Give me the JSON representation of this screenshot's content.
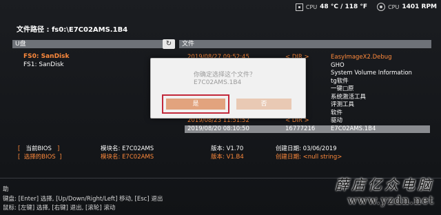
{
  "status": {
    "cpu_temp_label": "CPU",
    "cpu_temp_value": "48 °C / 118 °F",
    "cpu_fan_label": "CPU",
    "cpu_fan_value": "1401 RPM"
  },
  "path": {
    "label": "文件路径 : fs0:\\E7C02AMS.1B4"
  },
  "left_panel": {
    "title": "U盘",
    "refresh_icon": "↻",
    "drives": [
      {
        "label": "FS0: SanDisk",
        "selected": true
      },
      {
        "label": "FS1: SanDisk",
        "selected": false
      }
    ]
  },
  "right_panel": {
    "title": "文件",
    "files": [
      {
        "date": "2019/08/27 09:52:45",
        "type": "< DIR >",
        "name": "EasyImageX2.Debug"
      },
      {
        "date": "",
        "type": "",
        "name": "GHO"
      },
      {
        "date": "",
        "type": "",
        "name": "System Volume Information"
      },
      {
        "date": "",
        "type": "",
        "name": "tg软件"
      },
      {
        "date": "",
        "type": "",
        "name": "一键□原"
      },
      {
        "date": "",
        "type": "",
        "name": "系统激活工具"
      },
      {
        "date": "",
        "type": "",
        "name": "评测工具"
      },
      {
        "date": "",
        "type": "",
        "name": "软件"
      },
      {
        "date": "2019/08/23 11:51:52",
        "type": "< DIR >",
        "name": "驱动"
      },
      {
        "date": "2019/08/20 08:10:50",
        "type": "16777216",
        "name": "E7C02AMS.1B4"
      }
    ]
  },
  "dialog": {
    "question": "你确定选择这个文件？",
    "filename": "E7C02AMS.1B4",
    "yes_label": "是",
    "no_label": "否"
  },
  "info": {
    "current_bios_label": "当前BIOS",
    "current_model": "模块名: E7C02AMS",
    "current_version": "版本: V1.70",
    "current_created": "创建日期: 03/06/2019",
    "selected_bios_label": "选择的BIOS",
    "selected_model": "模块名: E7C02AMS",
    "selected_version": "版本: V1.B4",
    "selected_created": "创建日期: <null string>"
  },
  "help": {
    "title": "助",
    "keyboard": "键盘: [Enter] 选择, [Up/Down/Right/Left] 移动, [Esc] 退出",
    "mouse": "鼠标: [左键] 选择, [右键] 退出, [滚轮] 滚动"
  },
  "watermark": {
    "cn": "薛店亿众电脑",
    "url": "www.yzdn.net"
  },
  "colors": {
    "accent": "#ff8a3c",
    "highlight": "#8a8c90",
    "dialog_border": "#c2283a"
  }
}
